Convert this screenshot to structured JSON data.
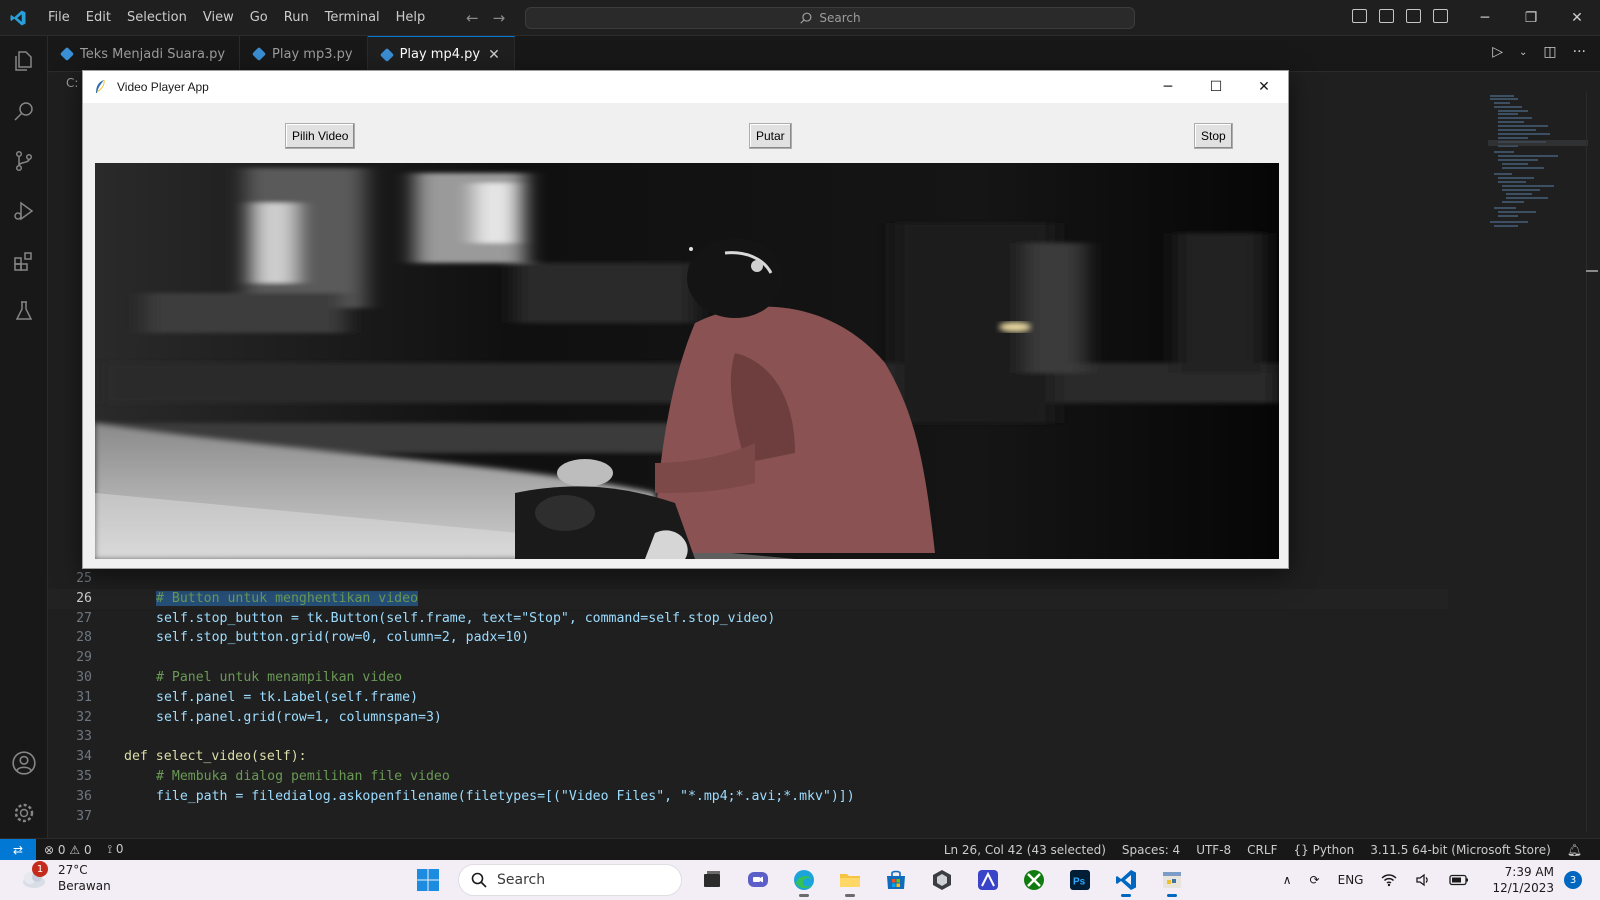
{
  "titlebar": {
    "menu": [
      "File",
      "Edit",
      "Selection",
      "View",
      "Go",
      "Run",
      "Terminal",
      "Help"
    ],
    "search_placeholder": "Search"
  },
  "tabs": [
    {
      "label": "Teks Menjadi Suara.py",
      "active": false
    },
    {
      "label": "Play mp3.py",
      "active": false
    },
    {
      "label": "Play mp4.py",
      "active": true
    }
  ],
  "editor": {
    "breadcrumb": "C:",
    "lines": [
      {
        "n": "25",
        "text": ""
      },
      {
        "n": "26",
        "text": "# Button untuk menghentikan video"
      },
      {
        "n": "27",
        "text": "self.stop_button = tk.Button(self.frame, text=\"Stop\", command=self.stop_video)"
      },
      {
        "n": "28",
        "text": "self.stop_button.grid(row=0, column=2, padx=10)"
      },
      {
        "n": "29",
        "text": ""
      },
      {
        "n": "30",
        "text": "# Panel untuk menampilkan video"
      },
      {
        "n": "31",
        "text": "self.panel = tk.Label(self.frame)"
      },
      {
        "n": "32",
        "text": "self.panel.grid(row=1, columnspan=3)"
      },
      {
        "n": "33",
        "text": ""
      },
      {
        "n": "34",
        "text": "def select_video(self):"
      },
      {
        "n": "35",
        "text": "# Membuka dialog pemilihan file video"
      },
      {
        "n": "36",
        "text": "file_path = filedialog.askopenfilename(filetypes=[(\"Video Files\", \"*.mp4;*.avi;*.mkv\")])"
      },
      {
        "n": "37",
        "text": ""
      }
    ]
  },
  "tk_window": {
    "title": "Video Player App",
    "buttons": {
      "select": "Pilih Video",
      "play": "Putar",
      "stop": "Stop"
    }
  },
  "statusbar": {
    "errors": "0",
    "warnings": "0",
    "ports": "0",
    "position": "Ln 26, Col 42 (43 selected)",
    "spaces": "Spaces: 4",
    "encoding": "UTF-8",
    "eol": "CRLF",
    "language": "Python",
    "interpreter": "3.11.5 64-bit (Microsoft Store)"
  },
  "taskbar": {
    "weather_temp": "27°C",
    "weather_desc": "Berawan",
    "weather_badge": "1",
    "search": "Search",
    "lang": "ENG",
    "time": "7:39 AM",
    "date": "12/1/2023",
    "notifications": "3"
  },
  "colors": {
    "accent": "#0078d4",
    "editor_bg": "#1f1f1f",
    "taskbar_bg": "#f3eef5"
  }
}
